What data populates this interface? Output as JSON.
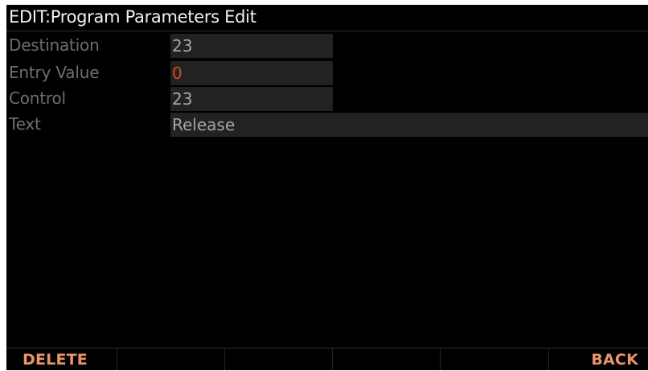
{
  "title": "EDIT:Program Parameters Edit",
  "params": [
    {
      "label": "Destination",
      "value": "23"
    },
    {
      "label": "Entry Value",
      "value": "0"
    },
    {
      "label": "Control",
      "value": "23"
    },
    {
      "label": "Text",
      "value": "Release"
    }
  ],
  "softkeys": [
    "DELETE",
    "",
    "",
    "",
    "",
    "BACK"
  ],
  "colors": {
    "background": "#000000",
    "label": "#6e6e6e",
    "value": "#a5a5a5",
    "value_highlight": "#d8481a",
    "softkey": "#e8946a",
    "field_bg": "#222222"
  }
}
